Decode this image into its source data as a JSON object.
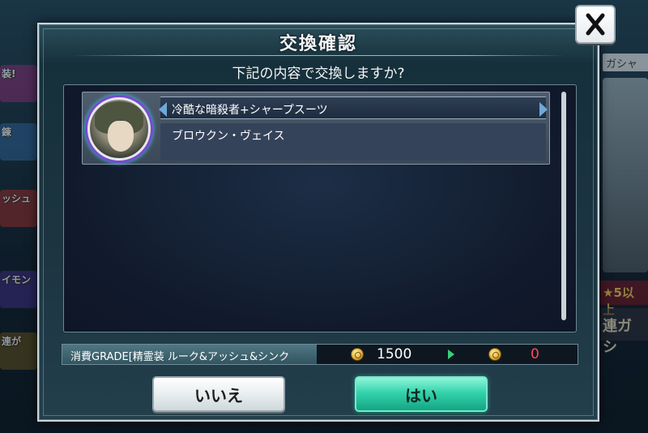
{
  "dialog": {
    "title": "交換確認",
    "question": "下記の内容で交換しますか?"
  },
  "item": {
    "name": "冷酷な暗殺者+シャープスーツ",
    "character": "ブロウクン・ヴェイス",
    "icon": "character-portrait"
  },
  "cost": {
    "label": "消費GRADE[精霊装 ルーク&アッシュ&シンク",
    "current": "1500",
    "after": "0",
    "icon": "coin-icon"
  },
  "buttons": {
    "no": "いいえ",
    "yes": "はい",
    "close_icon": "close-icon"
  },
  "background": {
    "gacha_tag": "ガシャ",
    "star_tag": "★5以上",
    "renga": "連ガシ",
    "left_banners": [
      "装!",
      "錬",
      "ッシュ",
      "イモン",
      "連が"
    ]
  },
  "colors": {
    "accent_yes": "#34d3ad",
    "after_value": "#ff4a55",
    "arrow": "#35d07a"
  }
}
